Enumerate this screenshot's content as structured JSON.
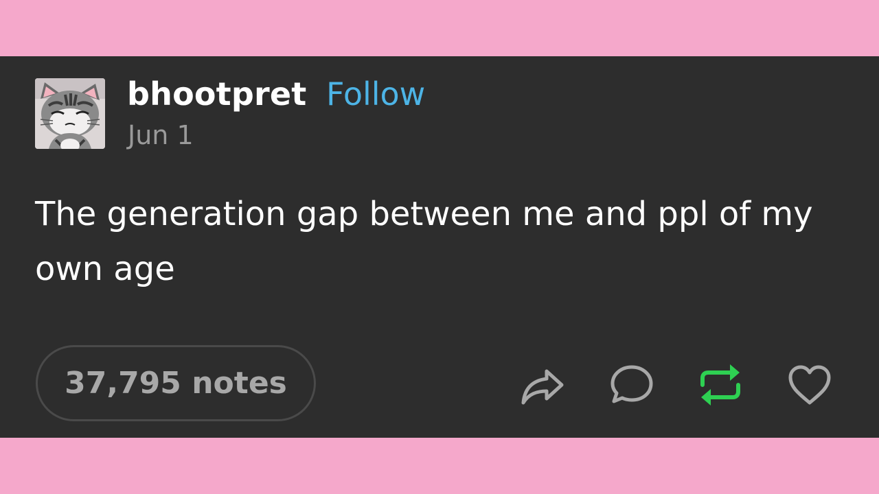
{
  "post": {
    "username": "bhootpret",
    "follow_label": "Follow",
    "date": "Jun 1",
    "text": "The generation gap between me and ppl of my own age",
    "notes": "37,795 notes"
  },
  "actions": {
    "share_icon": "share-arrow-icon",
    "reply_icon": "speech-bubble-icon",
    "reblog_icon": "reblog-icon",
    "like_icon": "heart-icon"
  },
  "colors": {
    "page_background": "#f5a8cb",
    "post_background": "#2d2d2d",
    "follow_accent": "#4db4e6",
    "reblog_green": "#2ed052",
    "muted_icon": "#a8a8a8"
  }
}
